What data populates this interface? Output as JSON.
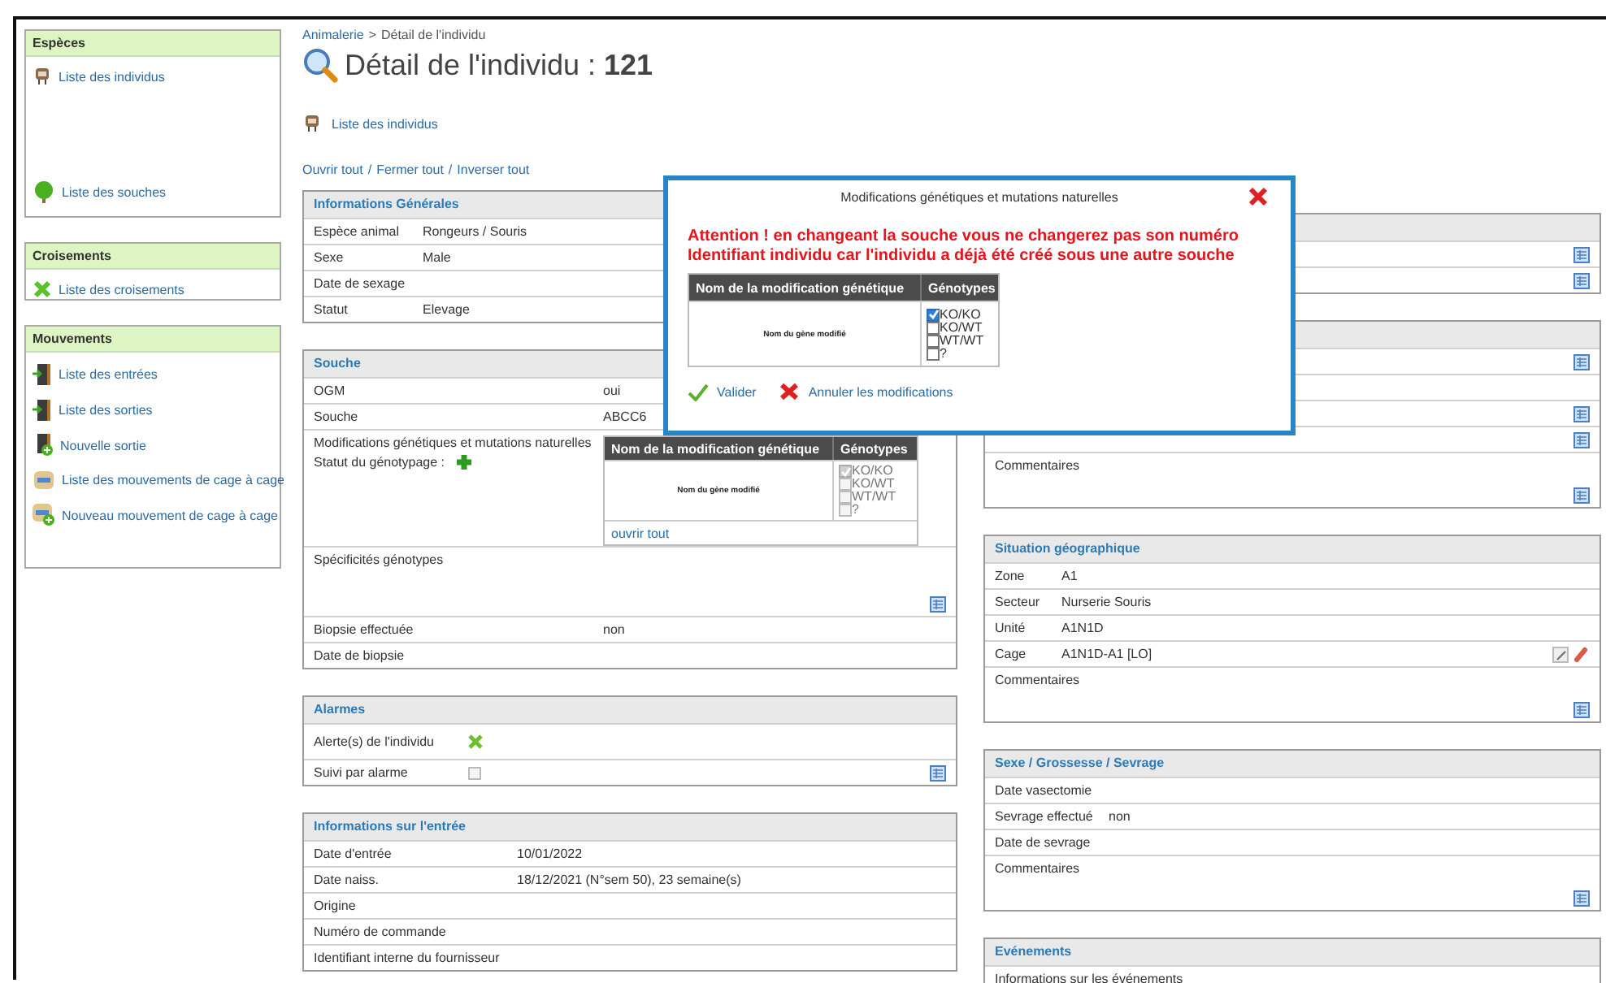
{
  "sidebar": {
    "sections": [
      {
        "title": "Espèces",
        "items": [
          {
            "label": "Liste des individus"
          },
          {
            "label": "Liste des souches"
          }
        ]
      },
      {
        "title": "Croisements",
        "items": [
          {
            "label": "Liste des croisements"
          }
        ]
      },
      {
        "title": "Mouvements",
        "items": [
          {
            "label": "Liste des entrées"
          },
          {
            "label": "Liste des sorties"
          },
          {
            "label": "Nouvelle sortie"
          },
          {
            "label": "Liste des mouvements de cage à cage"
          },
          {
            "label": "Nouveau mouvement de cage à cage"
          }
        ]
      }
    ]
  },
  "main": {
    "breadcrumb": [
      {
        "label": "Animalerie",
        "kind": "link"
      },
      {
        "label": "Détail de l'individu",
        "kind": "current"
      }
    ],
    "breadcrumb_separator": ">",
    "title": "Détail de l'individu : **121**",
    "back_link": "Liste des individus",
    "toggle_links": [
      "Ouvrir tout",
      "Fermer tout",
      "Inverser tout"
    ],
    "toggle_separator": "/",
    "panels": [
      {
        "title": "Informations Générales",
        "rows": [
          {
            "kind": "text",
            "label": "Espèce animal",
            "value": "Rongeurs / Souris"
          },
          {
            "kind": "text",
            "label": "Sexe",
            "value": "Male"
          },
          {
            "kind": "text",
            "label": "Date de sexage"
          },
          {
            "kind": "text",
            "label": "Statut",
            "value": "Elevage"
          }
        ]
      },
      {
        "title": "Souche",
        "rows": [
          {
            "kind": "text",
            "label": "OGM",
            "value": "oui"
          },
          {
            "kind": "text",
            "label": "Souche",
            "value": "ABCC6"
          },
          {
            "kind": "genetics",
            "label": "Modifications génétiques et mutations naturelles",
            "status_label": "Statut du génotypage :",
            "table": {
              "columns": [
                "Nom de la modification génétique",
                "Génotypes"
              ],
              "gene": "Nom du gène modifié",
              "genotypes": [
                {
                  "label": "KO/KO",
                  "checked": true,
                  "disabled": true
                },
                {
                  "label": "KO/WT",
                  "checked": false,
                  "disabled": true
                },
                {
                  "label": "WT/WT",
                  "checked": false,
                  "disabled": true
                },
                {
                  "label": "?",
                  "checked": false,
                  "disabled": true
                }
              ],
              "footer_link": "ouvrir tout"
            }
          },
          {
            "kind": "comment",
            "label": "Spécificités génotypes"
          },
          {
            "kind": "text",
            "label": "Biopsie effectuée",
            "value": "non"
          },
          {
            "kind": "text",
            "label": "Date de biopsie"
          }
        ]
      },
      {
        "title": "Alarmes",
        "rows": [
          {
            "kind": "alert",
            "label": "Alerte(s) de l'individu"
          },
          {
            "kind": "checkbox",
            "label": "Suivi par alarme",
            "checked": false,
            "disabled": true
          }
        ]
      },
      {
        "title": "Informations sur l'entrée",
        "rows": [
          {
            "kind": "text",
            "label": "Date d'entrée",
            "value": "10/01/2022"
          },
          {
            "kind": "text",
            "label": "Date naiss.",
            "value": "18/12/2021 (N°sem 50), 23 semaine(s)"
          },
          {
            "kind": "text",
            "label": "Origine"
          },
          {
            "kind": "text",
            "label": "Numéro de commande"
          },
          {
            "kind": "text",
            "label": "Identifiant interne du fournisseur"
          }
        ]
      }
    ]
  },
  "right": {
    "panels": [
      {
        "rows": [
          {
            "kind": "action"
          },
          {
            "kind": "action"
          }
        ]
      },
      {
        "rows": [
          {
            "kind": "action"
          },
          {
            "kind": "text"
          },
          {
            "kind": "action"
          },
          {
            "kind": "action"
          },
          {
            "kind": "comment",
            "label": "Commentaires"
          }
        ]
      },
      {
        "title": "Situation géographique",
        "rows": [
          {
            "kind": "text",
            "label": "Zone",
            "value": "A1"
          },
          {
            "kind": "text",
            "label": "Secteur",
            "value": "Nurserie Souris"
          },
          {
            "kind": "text",
            "label": "Unité",
            "value": "A1N1D"
          },
          {
            "kind": "cage",
            "label": "Cage",
            "value": "A1N1D-A1 [LO]"
          },
          {
            "kind": "comment",
            "label": "Commentaires"
          }
        ]
      },
      {
        "title": "Sexe / Grossesse / Sevrage",
        "rows": [
          {
            "kind": "text",
            "label": "Date vasectomie"
          },
          {
            "kind": "text",
            "label": "Sevrage effectué",
            "value": "non"
          },
          {
            "kind": "text",
            "label": "Date de sevrage"
          },
          {
            "kind": "comment",
            "label": "Commentaires"
          }
        ]
      },
      {
        "title": "Evénements",
        "rows": [
          {
            "kind": "text",
            "label": "Informations sur les événements"
          }
        ]
      }
    ]
  },
  "modal": {
    "title": "Modifications génétiques et mutations naturelles",
    "warning": "Attention ! en changeant la souche vous ne changerez pas son numéro Identifiant individu car l'individu a déjà été créé sous une autre souche",
    "table": {
      "columns": [
        "Nom de la modification génétique",
        "Génotypes"
      ],
      "gene": "Nom du gène modifié",
      "genotypes": [
        {
          "label": "KO/KO",
          "checked": true
        },
        {
          "label": "KO/WT",
          "checked": false
        },
        {
          "label": "WT/WT",
          "checked": false
        },
        {
          "label": "?",
          "checked": false
        }
      ]
    },
    "buttons": [
      {
        "label": "Valider",
        "kind": "confirm"
      },
      {
        "label": "Annuler les modifications",
        "kind": "cancel"
      }
    ]
  }
}
